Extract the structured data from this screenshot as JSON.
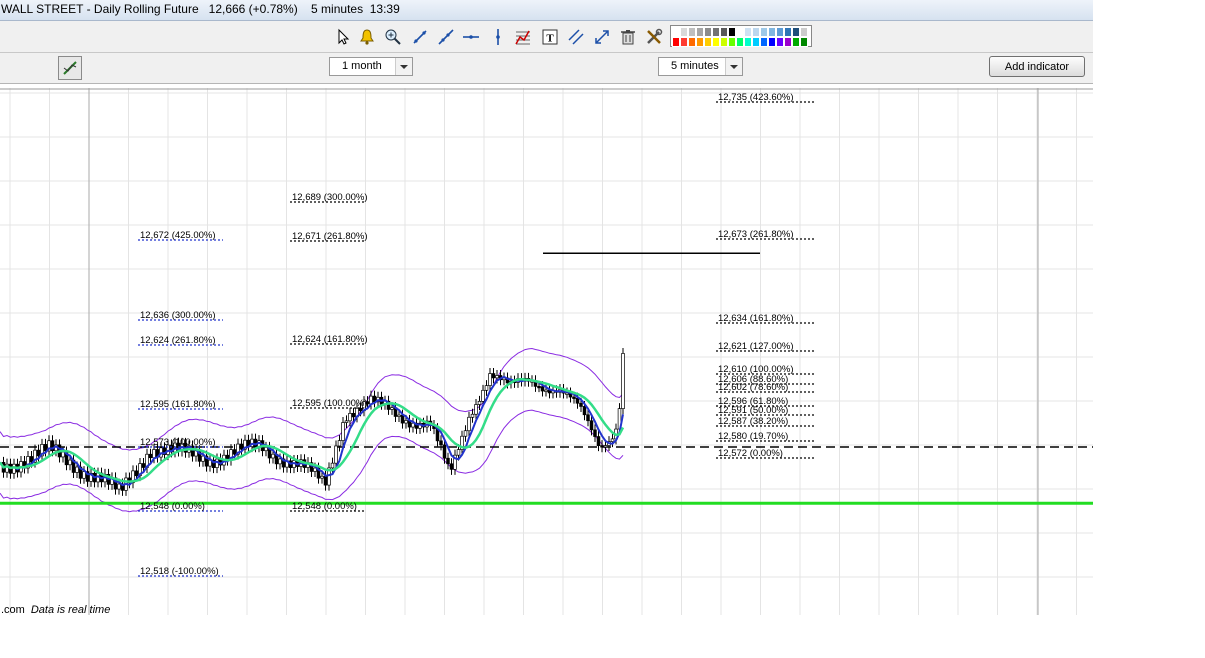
{
  "title": {
    "instrument": "WALL STREET - Daily Rolling Future",
    "price": "12,666 (+0.78%)",
    "interval": "5 minutes",
    "time": "13:39"
  },
  "toolbar": {
    "tools": [
      "pointer-icon",
      "alert-bell-icon",
      "zoom-icon",
      "trend-line-icon",
      "ray-line-icon",
      "horizontal-line-icon",
      "vertical-line-icon",
      "fibonacci-icon",
      "text-icon",
      "parallel-lines-icon",
      "expand-icon",
      "trash-icon",
      "settings-tools-icon"
    ],
    "palette": [
      "#ffffff",
      "#d9d9d9",
      "#bfbfbf",
      "#a6a6a6",
      "#8c8c8c",
      "#737373",
      "#595959",
      "#000000",
      "#ffffff",
      "#cfe2f3",
      "#bcd7ee",
      "#9ec9e8",
      "#7fb6e0",
      "#5b9bd5",
      "#2e75b6",
      "#1f4e79",
      "#cccccc",
      "#ff0000",
      "#ff3b30",
      "#ff6a00",
      "#ff9900",
      "#ffcc00",
      "#ffff00",
      "#ccff00",
      "#66ff00",
      "#00ff66",
      "#00ffcc",
      "#00ccff",
      "#0066ff",
      "#0000ff",
      "#6600ff",
      "#9900cc",
      "#00aa00",
      "#008800"
    ]
  },
  "controls": {
    "period": "1 month",
    "interval": "5 minutes",
    "add_indicator": "Add indicator"
  },
  "footer": {
    "source": ".com",
    "realtime": "Data is real time"
  },
  "chart_data": {
    "type": "candlestick",
    "fib_labels": {
      "g1": [
        "12,672 (425.00%)",
        "12,636 (300.00%)",
        "12,624 (261.80%)",
        "12,595 (161.80%)",
        "12,573 (100.00%)",
        "12,548 (0.00%)",
        "12,518 (-100.00%)"
      ],
      "g2": [
        "12,689 (300.00%)",
        "12,671 (261.80%)",
        "12,624 (161.80%)",
        "12,595 (100.00%)",
        "12,548 (0.00%)"
      ],
      "g3": [
        "12,735 (423.60%)",
        "12,673 (261.80%)",
        "12,634 (161.80%)",
        "12,621 (127.00%)",
        "12,610 (100.00%)",
        "12,606 (88.60%)",
        "12,602 (78.60%)",
        "12,596 (61.80%)",
        "12,591 (50.00%)",
        "12,587 (38.20%)",
        "12,580 (19.70%)",
        "12,572 (0.00%)"
      ]
    },
    "lines": {
      "green_support": 12548,
      "dashed_level": 12574,
      "black_resistance": 12673
    }
  }
}
